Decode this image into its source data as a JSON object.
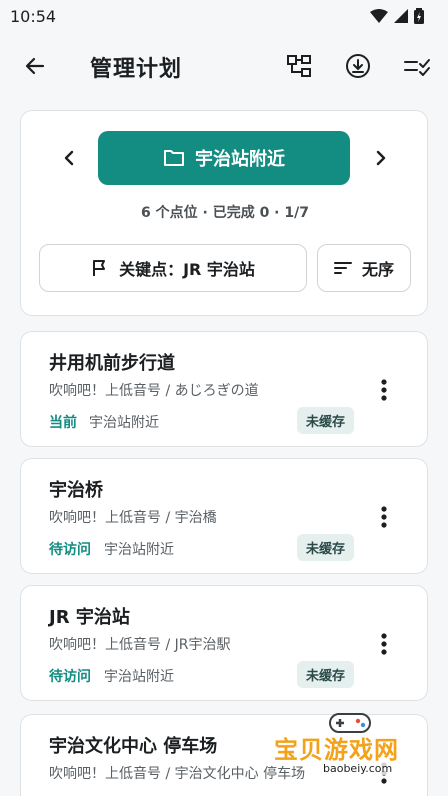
{
  "status_bar": {
    "time": "10:54"
  },
  "app_bar": {
    "title": "管理计划"
  },
  "group": {
    "name": "宇治站附近",
    "stats": "6 个点位 · 已完成 0 · 1/7",
    "keypoint_label": "关键点：JR 宇治站",
    "sort_label": "无序"
  },
  "pois": [
    {
      "title": "井用机前步行道",
      "subtitle": "吹响吧！上低音号 / あじろぎの道",
      "status": "当前",
      "group": "宇治站附近",
      "badge": "未缓存"
    },
    {
      "title": "宇治桥",
      "subtitle": "吹响吧！上低音号 / 宇治橋",
      "status": "待访问",
      "group": "宇治站附近",
      "badge": "未缓存"
    },
    {
      "title": "JR 宇治站",
      "subtitle": "吹响吧！上低音号 / JR宇治駅",
      "status": "待访问",
      "group": "宇治站附近",
      "badge": "未缓存"
    },
    {
      "title": "宇治文化中心 停车场",
      "subtitle": "吹响吧！上低音号 / 宇治文化中心 停车场",
      "status": "",
      "group": "",
      "badge": ""
    }
  ],
  "watermark": {
    "text": "宝贝游戏网",
    "url": "baobeiy.com"
  },
  "colors": {
    "accent": "#138c82",
    "badge_bg": "#e4efee",
    "watermark": "#f3a21a"
  }
}
